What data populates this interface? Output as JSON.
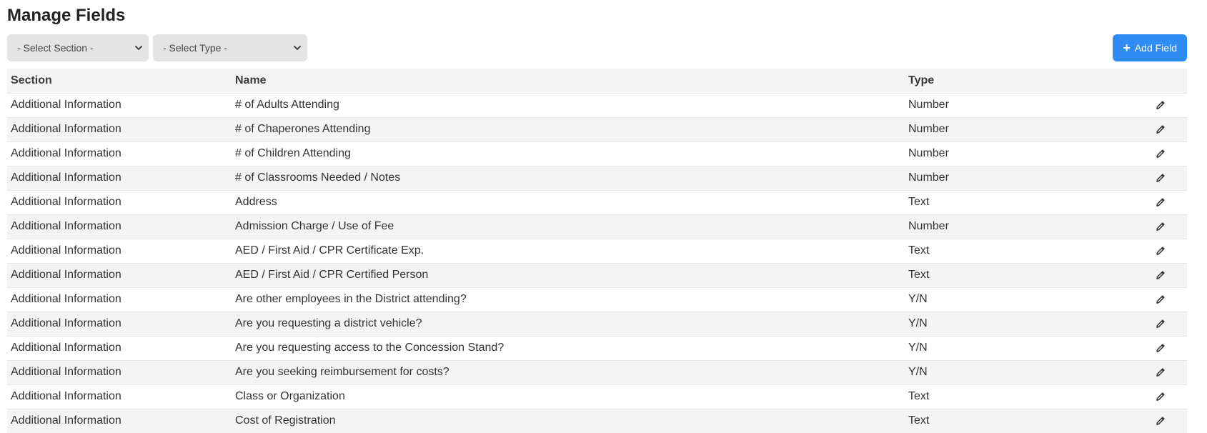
{
  "header": {
    "title": "Manage Fields"
  },
  "filters": {
    "section_select": "- Select Section -",
    "type_select": "- Select Type -"
  },
  "actions": {
    "add_field_label": "Add Field"
  },
  "table": {
    "headers": [
      "Section",
      "Name",
      "Type",
      ""
    ],
    "rows": [
      {
        "section": "Additional Information",
        "name": "# of Adults Attending",
        "type": "Number"
      },
      {
        "section": "Additional Information",
        "name": "# of Chaperones Attending",
        "type": "Number"
      },
      {
        "section": "Additional Information",
        "name": "# of Children Attending",
        "type": "Number"
      },
      {
        "section": "Additional Information",
        "name": "# of Classrooms Needed / Notes",
        "type": "Number"
      },
      {
        "section": "Additional Information",
        "name": "Address",
        "type": "Text"
      },
      {
        "section": "Additional Information",
        "name": "Admission Charge / Use of Fee",
        "type": "Number"
      },
      {
        "section": "Additional Information",
        "name": "AED / First Aid / CPR Certificate Exp.",
        "type": "Text"
      },
      {
        "section": "Additional Information",
        "name": "AED / First Aid / CPR Certified Person",
        "type": "Text"
      },
      {
        "section": "Additional Information",
        "name": "Are other employees in the District attending?",
        "type": "Y/N"
      },
      {
        "section": "Additional Information",
        "name": "Are you requesting a district vehicle?",
        "type": "Y/N"
      },
      {
        "section": "Additional Information",
        "name": "Are you requesting access to the Concession Stand?",
        "type": "Y/N"
      },
      {
        "section": "Additional Information",
        "name": "Are you seeking reimbursement for costs?",
        "type": "Y/N"
      },
      {
        "section": "Additional Information",
        "name": "Class or Organization",
        "type": "Text"
      },
      {
        "section": "Additional Information",
        "name": "Cost of Registration",
        "type": "Text"
      }
    ]
  },
  "icons": {
    "row_action": "pencil-icon",
    "select_arrow": "chevron-down-icon",
    "add": "plus-icon"
  },
  "colors": {
    "accent": "#2f8cf3",
    "stripe": "#f4f4f4",
    "select_bg": "#e4e4e4"
  }
}
